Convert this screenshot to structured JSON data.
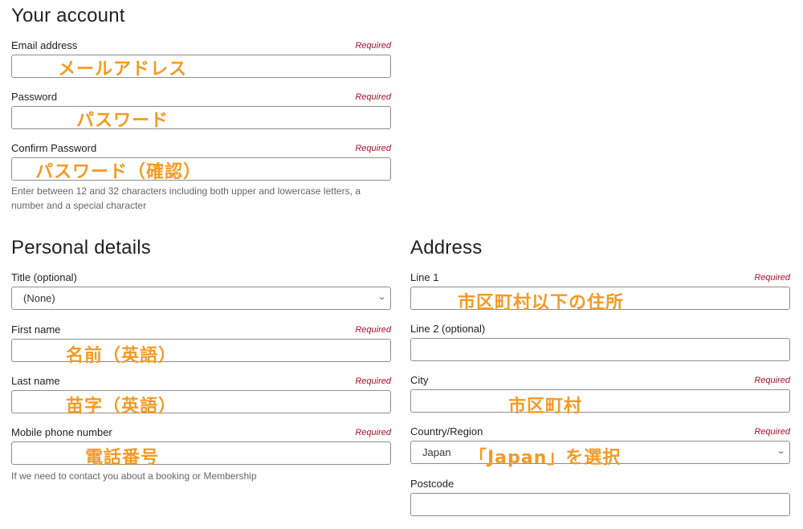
{
  "account": {
    "title": "Your account",
    "email": {
      "label": "Email address",
      "required": "Required",
      "annotation": "メールアドレス"
    },
    "password": {
      "label": "Password",
      "required": "Required",
      "annotation": "パスワード"
    },
    "confirm": {
      "label": "Confirm Password",
      "required": "Required",
      "annotation": "パスワード（確認）"
    },
    "hint": "Enter between 12 and 32 characters including both upper and lowercase letters, a number and a special character"
  },
  "personal": {
    "title": "Personal details",
    "title_field": {
      "label": "Title (optional)",
      "value": "(None)"
    },
    "first_name": {
      "label": "First name",
      "required": "Required",
      "annotation": "名前（英語）"
    },
    "last_name": {
      "label": "Last name",
      "required": "Required",
      "annotation": "苗字（英語）"
    },
    "mobile": {
      "label": "Mobile phone number",
      "required": "Required",
      "annotation": "電話番号",
      "hint": "If we need to contact you about a booking or Membership"
    }
  },
  "address": {
    "title": "Address",
    "line1": {
      "label": "Line 1",
      "required": "Required",
      "annotation": "市区町村以下の住所"
    },
    "line2": {
      "label": "Line 2 (optional)"
    },
    "city": {
      "label": "City",
      "required": "Required",
      "annotation": "市区町村"
    },
    "country": {
      "label": "Country/Region",
      "required": "Required",
      "value": "Japan",
      "annotation": "「Japan」を選択"
    },
    "postcode": {
      "label": "Postcode"
    }
  },
  "colors": {
    "required": "#b0102b",
    "annotation": "#f59a23",
    "border": "#8d8d8d"
  },
  "icons": {
    "select_arrow": "chevron-down-icon"
  }
}
